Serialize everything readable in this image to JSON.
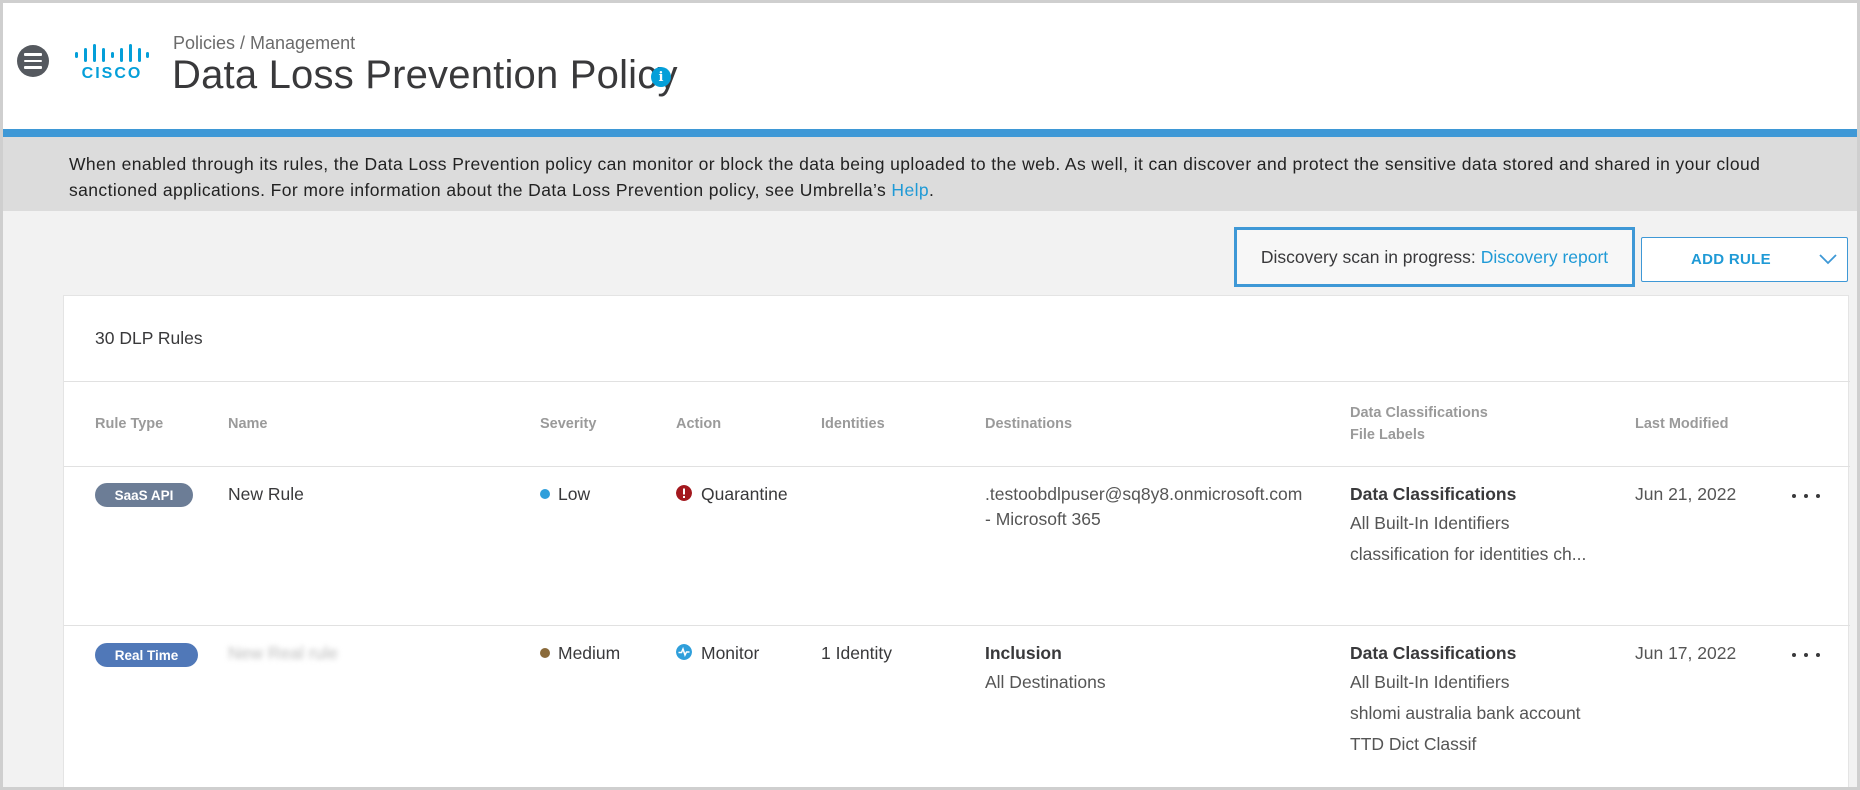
{
  "header": {
    "breadcrumb": "Policies / Management",
    "title": "Data Loss Prevention Policy",
    "logo_text": "CISCO",
    "info_icon": "i"
  },
  "banner": {
    "text": "When enabled through its rules, the Data Loss Prevention policy can monitor or block the data being uploaded to the web. As well, it can discover and protect the sensitive data stored and shared in your cloud sanctioned applications. For more information about the Data Loss Prevention policy, see Umbrella’s",
    "link": "Help",
    "suffix": "."
  },
  "discovery": {
    "label": "Discovery scan in progress:",
    "link": "Discovery report"
  },
  "add_rule": {
    "label": "ADD RULE"
  },
  "table": {
    "count_label": "30 DLP Rules",
    "columns": {
      "rule_type": "Rule Type",
      "name": "Name",
      "severity": "Severity",
      "action": "Action",
      "identities": "Identities",
      "destinations": "Destinations",
      "data_class_1": "Data Classifications",
      "data_class_2": "File Labels",
      "last_modified": "Last Modified"
    },
    "rows": [
      {
        "rule_type": "SaaS API",
        "name": "New Rule",
        "severity": "Low",
        "action": "Quarantine",
        "identities": "",
        "dest_1": ".testoobdlpuser@sq8y8.onmicrosoft.com",
        "dest_2": "- Microsoft 365",
        "dc_heading": "Data Classifications",
        "dc_1": "All Built-In Identifiers",
        "dc_2": "classification for identities ch...",
        "last_modified": "Jun 21, 2022"
      },
      {
        "rule_type": "Real Time",
        "name": "New Real rule",
        "severity": "Medium",
        "action": "Monitor",
        "identities": "1 Identity",
        "dest_1": "Inclusion",
        "dest_2": "All Destinations",
        "dc_heading": "Data Classifications",
        "dc_1": "All Built-In Identifiers",
        "dc_2": "shlomi australia bank account",
        "dc_3": "TTD Dict Classif",
        "last_modified": "Jun 17, 2022"
      }
    ]
  },
  "colors": {
    "accent": "#3e98d6",
    "link": "#1f9ad6",
    "severity_low": "#2f9fdb",
    "severity_medium": "#8a6a3a",
    "quarantine": "#a3181e",
    "monitor": "#2f9fdb"
  },
  "icons": {
    "menu": "hamburger-menu-icon",
    "info": "info-icon",
    "chevron": "chevron-down-icon",
    "quarantine": "quarantine-icon",
    "monitor": "monitor-icon",
    "more": "more-options-icon"
  }
}
